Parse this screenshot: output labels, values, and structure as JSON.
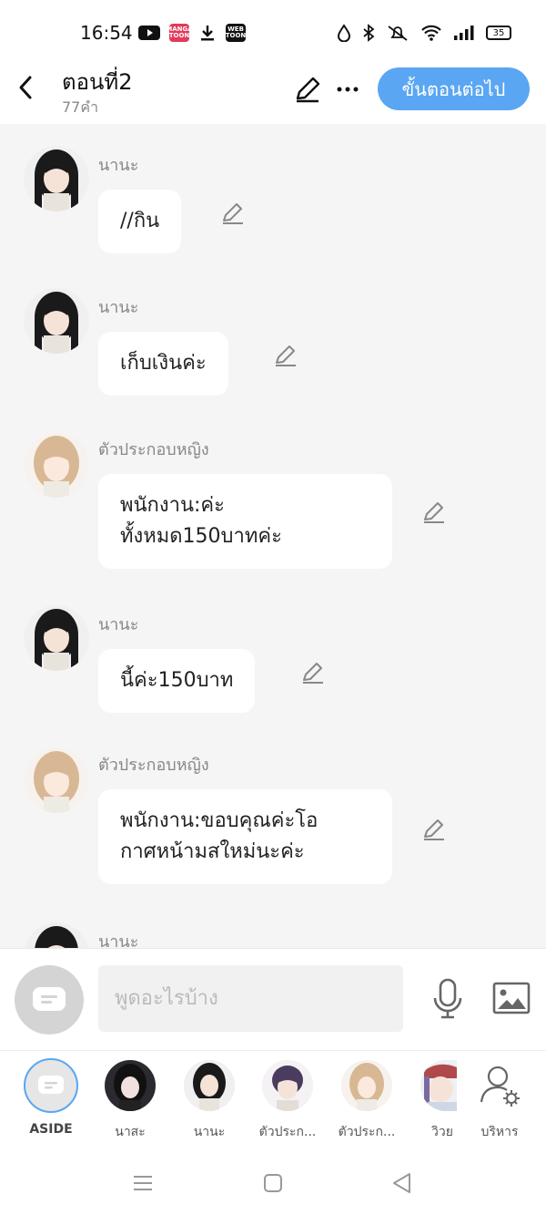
{
  "status": {
    "time": "16:54",
    "battery": "35",
    "apps": [
      {
        "name": "youtube-icon",
        "label": "",
        "color": "#111111"
      },
      {
        "name": "mangatoon-icon",
        "label": "MANGA TOON",
        "color": "#e23a5a"
      },
      {
        "name": "download-icon",
        "label": "",
        "color": "#111111"
      },
      {
        "name": "webtoon-icon",
        "label": "WEB TOON",
        "color": "#111111"
      }
    ]
  },
  "header": {
    "title": "ตอนที่2",
    "word_count": "77คำ",
    "next_button": "ขั้นตอนต่อไป"
  },
  "messages": [
    {
      "speaker": "นานะ",
      "text": "//กิน",
      "avatar": "nana-avatar"
    },
    {
      "speaker": "นานะ",
      "text": "เก็บเงินค่ะ",
      "avatar": "nana-avatar"
    },
    {
      "speaker": "ตัวประกอบหญิง",
      "text": "พนักงาน:ค่ะ\nทั้งหมด150บาทค่ะ",
      "avatar": "extra-female-avatar"
    },
    {
      "speaker": "นานะ",
      "text": "นี้ค่ะ150บาท",
      "avatar": "nana-avatar"
    },
    {
      "speaker": "ตัวประกอบหญิง",
      "text": "พนักงาน:ขอบคุณค่ะโอ\nกาศหน้ามสใหม่นะค่ะ",
      "avatar": "extra-female-avatar"
    },
    {
      "speaker": "นานะ",
      "text": "",
      "avatar": "nana-avatar"
    }
  ],
  "composer": {
    "placeholder": "พูดอะไรบ้าง"
  },
  "characters": [
    {
      "label": "ASIDE"
    },
    {
      "label": "นาสะ"
    },
    {
      "label": "นานะ"
    },
    {
      "label": "ตัวประก..."
    },
    {
      "label": "ตัวประก..."
    },
    {
      "label": "วิวย"
    },
    {
      "label": "บริหาร"
    }
  ],
  "colors": {
    "accent": "#5aa6f2",
    "background": "#f5f5f5"
  }
}
